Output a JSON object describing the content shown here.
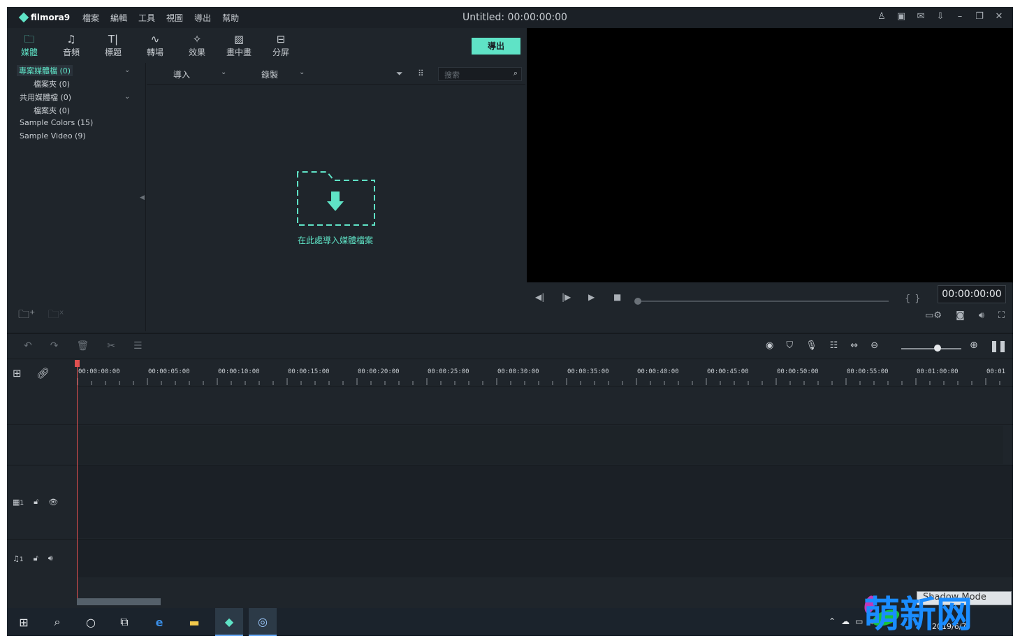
{
  "app": {
    "logo": "filmora9",
    "title": "Untitled:  00:00:00:00",
    "menu": [
      "檔案",
      "編輯",
      "工具",
      "視圖",
      "導出",
      "幫助"
    ]
  },
  "tabs": [
    {
      "label": "媒體",
      "icon": "folder-icon"
    },
    {
      "label": "音頻",
      "icon": "music-icon"
    },
    {
      "label": "標題",
      "icon": "text-icon"
    },
    {
      "label": "轉場",
      "icon": "transition-icon"
    },
    {
      "label": "效果",
      "icon": "effects-icon"
    },
    {
      "label": "畫中畫",
      "icon": "image-icon"
    },
    {
      "label": "分屏",
      "icon": "split-icon"
    }
  ],
  "export_label": "導出",
  "library": {
    "project_media": "專案媒體檔 (0)",
    "project_folder": "檔案夾 (0)",
    "shared_media": "共用媒體檔 (0)",
    "shared_folder": "檔案夾 (0)",
    "sample_colors": "Sample Colors (15)",
    "sample_video": "Sample Video (9)"
  },
  "media": {
    "import_label": "導入",
    "record_label": "錄製",
    "search_placeholder": "搜索",
    "drop_text": "在此處導入媒體檔案"
  },
  "preview": {
    "time": "00:00:00:00",
    "progress": 0
  },
  "timeline": {
    "ticks": [
      "00:00:00:00",
      "00:00:05:00",
      "00:00:10:00",
      "00:00:15:00",
      "00:00:20:00",
      "00:00:25:00",
      "00:00:30:00",
      "00:00:35:00",
      "00:00:40:00",
      "00:00:45:00",
      "00:00:50:00",
      "00:00:55:00",
      "00:01:00:00",
      "00:01"
    ],
    "video_track": "1",
    "audio_track": "1",
    "zoom_level": 0.6
  },
  "overlay": {
    "shadow_mode": "Shadow Mode",
    "watermark": "萌新网",
    "date": "2019/6/7"
  },
  "colors": {
    "accent": "#5fe3c6",
    "playhead": "#e05050",
    "background": "#1f252b"
  }
}
